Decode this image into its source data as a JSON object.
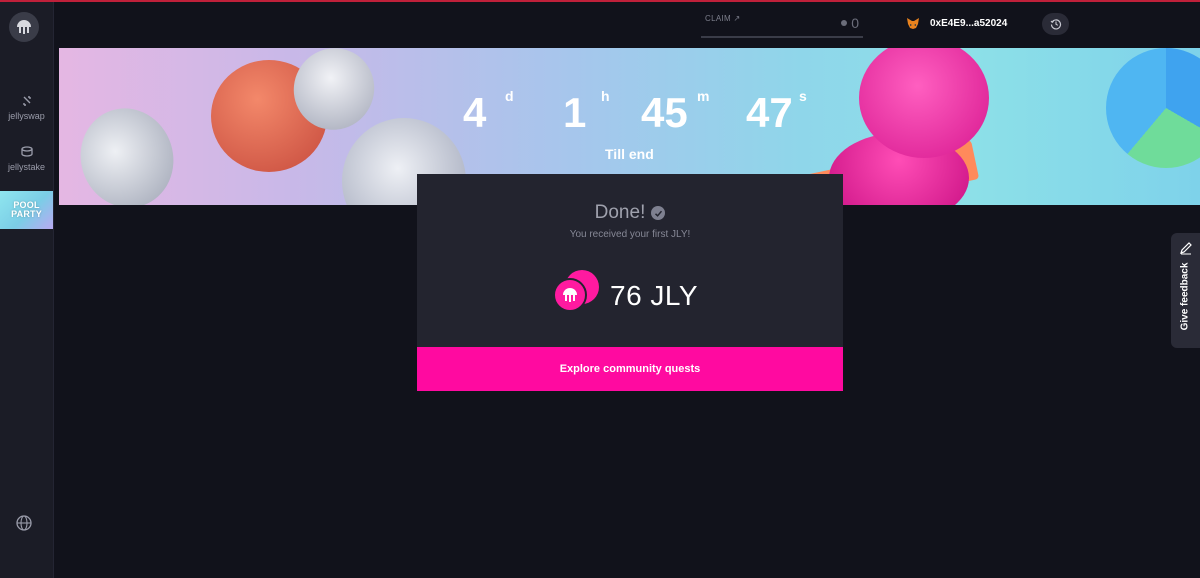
{
  "sidebar": {
    "nav": [
      {
        "label": "jellyswap",
        "icon": "swap-icon"
      },
      {
        "label": "jellystake",
        "icon": "stake-icon"
      }
    ],
    "pool_party": {
      "line1": "POOL",
      "line2": "PARTY"
    },
    "footer_icon": "globe-icon"
  },
  "header": {
    "claim_label": "CLAIM ↗",
    "claim_value": "0",
    "wallet_address": "0xE4E9...a52024"
  },
  "banner": {
    "countdown": {
      "days": "4",
      "days_unit": "d",
      "hours": "1",
      "hours_unit": "h",
      "minutes": "45",
      "minutes_unit": "m",
      "seconds": "47",
      "seconds_unit": "s"
    },
    "subtitle": "Till end"
  },
  "modal": {
    "title": "Done!",
    "message": "You received your first JLY!",
    "amount": "76 JLY",
    "cta_label": "Explore community quests"
  },
  "feedback": {
    "label": "Give feedback"
  },
  "colors": {
    "accent": "#ff0aa0",
    "background": "#11121b",
    "card": "#23242f"
  }
}
